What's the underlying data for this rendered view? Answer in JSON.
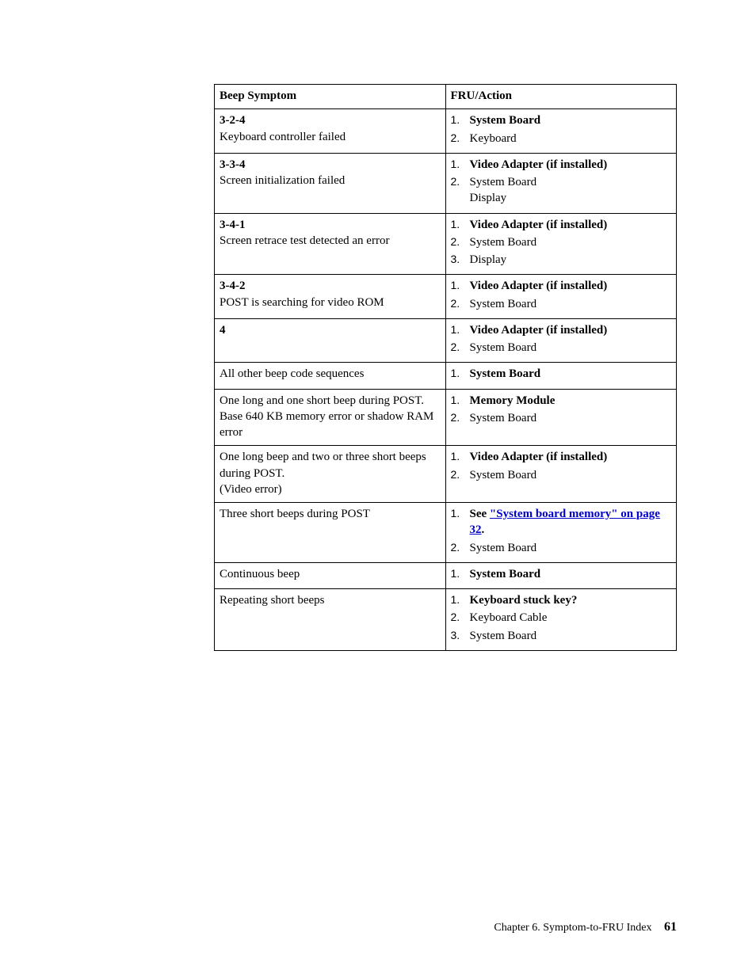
{
  "headers": {
    "symptom": "Beep Symptom",
    "action": "FRU/Action"
  },
  "rows": [
    {
      "code": "3-2-4",
      "desc": "Keyboard controller failed",
      "actions": [
        {
          "text": "System Board",
          "bold": true
        },
        {
          "text": "Keyboard",
          "bold": false
        }
      ]
    },
    {
      "code": "3-3-4",
      "desc": "Screen initialization failed",
      "actions": [
        {
          "text": "Video Adapter (if installed)",
          "bold": true
        },
        {
          "text": "System Board",
          "text2": "Display",
          "bold": false
        }
      ]
    },
    {
      "code": "3-4-1",
      "desc": "Screen retrace test detected an error",
      "actions": [
        {
          "text": "Video Adapter (if installed)",
          "bold": true
        },
        {
          "text": "System Board",
          "bold": false
        },
        {
          "text": "Display",
          "bold": false
        }
      ]
    },
    {
      "code": "3-4-2",
      "desc": "POST is searching for video ROM",
      "actions": [
        {
          "text": "Video Adapter (if installed)",
          "bold": true
        },
        {
          "text": "System Board",
          "bold": false
        }
      ]
    },
    {
      "code": "4",
      "desc": "",
      "actions": [
        {
          "text": "Video Adapter (if installed)",
          "bold": true
        },
        {
          "text": "System Board",
          "bold": false
        }
      ]
    },
    {
      "plain": "All other beep code sequences",
      "actions": [
        {
          "text": "System Board",
          "bold": true
        }
      ]
    },
    {
      "plain": "One long and one short beep during POST.",
      "plain2": "Base 640 KB memory error or shadow RAM error",
      "actions": [
        {
          "text": "Memory Module",
          "bold": true
        },
        {
          "text": "System Board",
          "bold": false
        }
      ]
    },
    {
      "plain": "One long beep and two or three short beeps during POST.",
      "plain2": "(Video error)",
      "actions": [
        {
          "text": "Video Adapter (if installed)",
          "bold": true
        },
        {
          "text": "System Board",
          "bold": false
        }
      ]
    },
    {
      "plain": "Three short beeps during POST",
      "actions": [
        {
          "text_prefix": "See ",
          "link": "\"System board memory\" on page 32",
          "text_suffix": ".",
          "bold": true
        },
        {
          "text": "System Board",
          "bold": false
        }
      ]
    },
    {
      "plain": "Continuous beep",
      "actions": [
        {
          "text": "System Board",
          "bold": true
        }
      ]
    },
    {
      "plain": "Repeating short beeps",
      "actions": [
        {
          "text": "Keyboard stuck key?",
          "bold": true
        },
        {
          "text": "Keyboard Cable",
          "bold": false
        },
        {
          "text": "System Board",
          "bold": false
        }
      ]
    }
  ],
  "footer": {
    "chapter": "Chapter 6. Symptom-to-FRU Index",
    "page": "61"
  }
}
